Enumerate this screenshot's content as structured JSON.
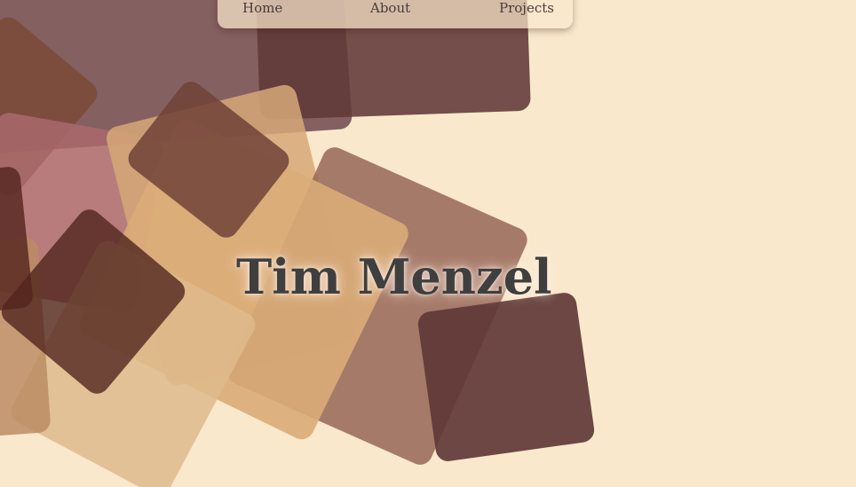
{
  "nav": {
    "items": [
      {
        "label": "Home"
      },
      {
        "label": "About"
      },
      {
        "label": "Projects"
      }
    ]
  },
  "hero": {
    "title": "Tim Menzel"
  },
  "colors": {
    "background": "#fae8cc",
    "title_text": "#3f3f3f",
    "nav_text": "#4a3b3b"
  }
}
